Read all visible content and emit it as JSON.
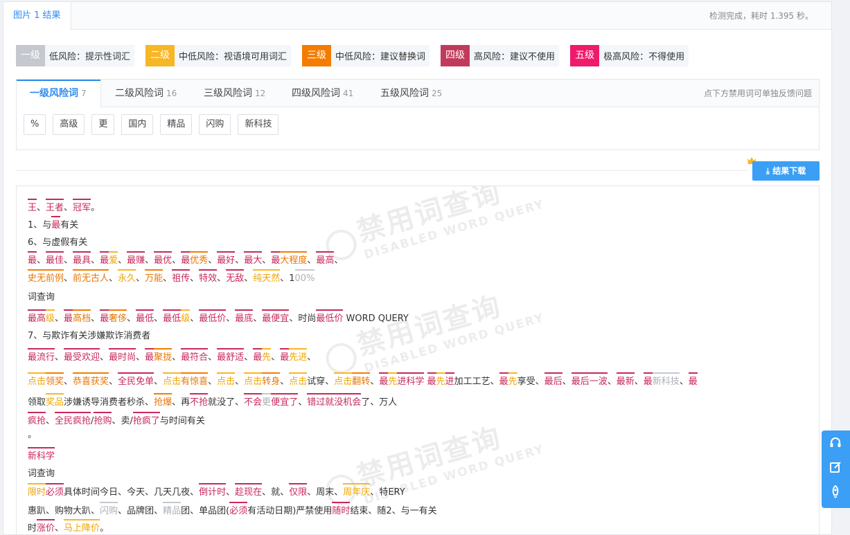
{
  "top": {
    "result_tab": "图片 1 结果",
    "status": "检测完成，耗时 1.395 秒。"
  },
  "legend": [
    {
      "level": "一级",
      "desc": "低风险：提示性词汇",
      "color": "#c5c8ce"
    },
    {
      "level": "二级",
      "desc": "中低风险：视语境可用词汇",
      "color": "#f7b624"
    },
    {
      "level": "三级",
      "desc": "中低风险：建议替换词",
      "color": "#f57c00"
    },
    {
      "level": "四级",
      "desc": "高风险：建议不使用",
      "color": "#c23a5b"
    },
    {
      "level": "五级",
      "desc": "极高风险：不得使用",
      "color": "#f01a6b"
    }
  ],
  "tabs": [
    {
      "label": "一级风险词",
      "count": "7"
    },
    {
      "label": "二级风险词",
      "count": "16"
    },
    {
      "label": "三级风险词",
      "count": "12"
    },
    {
      "label": "四级风险词",
      "count": "41"
    },
    {
      "label": "五级风险词",
      "count": "25"
    }
  ],
  "tabs_hint": "点下方禁用词可单独反馈问题",
  "chips": [
    "%",
    "高级",
    "更",
    "国内",
    "精品",
    "闪购",
    "新科技"
  ],
  "download_label": "结果下载",
  "watermark": {
    "big": "禁用词查询",
    "small": "DISABLED WORD QUERY"
  },
  "content_lines": [
    [
      [
        "王",
        4
      ],
      [
        "、",
        0
      ],
      [
        "王者",
        4
      ],
      [
        "、",
        0
      ],
      [
        "冠军",
        4
      ],
      [
        "。",
        0
      ]
    ],
    [
      [
        "1、与",
        0
      ],
      [
        "最",
        4
      ],
      [
        "有关",
        0
      ]
    ],
    [
      [
        "6、与虚假有关",
        0
      ]
    ],
    [
      [
        "最",
        4
      ],
      [
        "、",
        0
      ],
      [
        "最佳",
        4
      ],
      [
        "、",
        0
      ],
      [
        "最具",
        4
      ],
      [
        "、",
        0
      ],
      [
        "最",
        4
      ],
      [
        "爱",
        2
      ],
      [
        "、",
        0
      ],
      [
        "最赚",
        4
      ],
      [
        "、",
        0
      ],
      [
        "最优",
        4
      ],
      [
        "、",
        0
      ],
      [
        "最",
        4
      ],
      [
        "优秀",
        3
      ],
      [
        "、",
        0
      ],
      [
        "最好",
        4
      ],
      [
        "、",
        0
      ],
      [
        "最大",
        4
      ],
      [
        "、",
        0
      ],
      [
        "最",
        4
      ],
      [
        "大程度",
        3
      ],
      [
        "、",
        0
      ],
      [
        "最高",
        4
      ],
      [
        "、",
        0
      ]
    ],
    [
      [
        "史无前例",
        3
      ],
      [
        "、",
        0
      ],
      [
        "前无古人",
        3
      ],
      [
        "、",
        0
      ],
      [
        "永久",
        2
      ],
      [
        "、",
        0
      ],
      [
        "万能",
        3
      ],
      [
        "、",
        0
      ],
      [
        "祖传",
        4
      ],
      [
        "、",
        0
      ],
      [
        "特效",
        4
      ],
      [
        "、",
        0
      ],
      [
        "无敌",
        4
      ],
      [
        "、",
        0
      ],
      [
        "纯天然",
        2
      ],
      [
        "、",
        0
      ],
      [
        "1",
        0
      ],
      [
        "00%",
        1
      ]
    ],
    [
      [
        "词查询",
        0
      ]
    ],
    [
      [
        "最高",
        4
      ],
      [
        "级",
        2
      ],
      [
        "、",
        0
      ],
      [
        "最",
        4
      ],
      [
        "高档",
        3
      ],
      [
        "、",
        0
      ],
      [
        "最",
        4
      ],
      [
        "奢侈",
        3
      ],
      [
        "、",
        0
      ],
      [
        "最低",
        4
      ],
      [
        "、",
        0
      ],
      [
        "最",
        4
      ],
      [
        "低",
        4
      ],
      [
        "级",
        2
      ],
      [
        "、",
        0
      ],
      [
        "最低价",
        4
      ],
      [
        "、",
        0
      ],
      [
        "最底",
        4
      ],
      [
        "、",
        0
      ],
      [
        "最便宜",
        4
      ],
      [
        "、",
        0
      ],
      [
        "时尚",
        0
      ],
      [
        "最低价",
        4
      ],
      [
        " WORD QUERY",
        0
      ]
    ],
    [
      [
        "7、与欺诈有关涉嫌欺诈消费者",
        0
      ]
    ],
    [
      [
        "最流行",
        4
      ],
      [
        "、",
        0
      ],
      [
        "最受欢迎",
        4
      ],
      [
        "、",
        0
      ],
      [
        "最时尚",
        4
      ],
      [
        "、",
        0
      ],
      [
        "最",
        4
      ],
      [
        "聚拢",
        3
      ],
      [
        "、",
        0
      ],
      [
        "最符合",
        4
      ],
      [
        "、",
        0
      ],
      [
        "最舒适",
        4
      ],
      [
        "、",
        0
      ],
      [
        "最",
        4
      ],
      [
        "先",
        2
      ],
      [
        "、",
        0
      ],
      [
        "最",
        4
      ],
      [
        "先进",
        2
      ],
      [
        "、",
        0
      ]
    ],
    [
      [
        "点击",
        2
      ],
      [
        "领奖",
        3
      ],
      [
        "、",
        0
      ],
      [
        "恭喜获奖",
        3
      ],
      [
        "、",
        0
      ],
      [
        "全民免单",
        4
      ],
      [
        "、",
        0
      ],
      [
        "点击",
        2
      ],
      [
        "有惊喜",
        3
      ],
      [
        "、",
        0
      ],
      [
        "点击",
        2
      ],
      [
        "、",
        0
      ],
      [
        "点击",
        2
      ],
      [
        "转身",
        3
      ],
      [
        "、",
        0
      ],
      [
        "点击",
        2
      ],
      [
        "试穿",
        0
      ],
      [
        "、",
        0
      ],
      [
        "点击",
        2
      ],
      [
        "翻转",
        3
      ],
      [
        "、",
        0
      ],
      [
        "最",
        4
      ],
      [
        "先",
        2
      ],
      [
        "进科学",
        4
      ],
      [
        " ",
        0
      ],
      [
        "最",
        4
      ],
      [
        "先",
        2
      ],
      [
        "进",
        4
      ],
      [
        "加工工艺",
        0
      ],
      [
        "、",
        0
      ],
      [
        "最",
        4
      ],
      [
        "先",
        2
      ],
      [
        "享受",
        0
      ],
      [
        "、",
        0
      ],
      [
        "最后",
        4
      ],
      [
        "、",
        0
      ],
      [
        "最后一波",
        4
      ],
      [
        "、",
        0
      ],
      [
        "最新",
        4
      ],
      [
        "、",
        0
      ],
      [
        "最",
        4
      ],
      [
        "新科技",
        1
      ],
      [
        "、",
        0
      ],
      [
        "最",
        4
      ]
    ],
    [
      [
        "领取",
        0
      ],
      [
        "奖品",
        2
      ],
      [
        "涉嫌诱导消费者秒杀",
        0
      ],
      [
        "、",
        0
      ],
      [
        "抢爆",
        3
      ],
      [
        "、",
        0
      ],
      [
        "再",
        0
      ],
      [
        "不抢",
        4
      ],
      [
        "就没了",
        0
      ],
      [
        "、",
        0
      ],
      [
        "不会",
        4
      ],
      [
        "更",
        1
      ],
      [
        "便宜了",
        4
      ],
      [
        "、",
        0
      ],
      [
        "错过",
        4
      ],
      [
        "就没机会",
        4
      ],
      [
        "了",
        0
      ],
      [
        "、",
        0
      ],
      [
        "万人",
        0
      ]
    ],
    [
      [
        "疯抢",
        4
      ],
      [
        "、",
        0
      ],
      [
        "全民疯抢",
        4
      ],
      [
        "/",
        0
      ],
      [
        "抢购",
        4
      ],
      [
        "、",
        0
      ],
      [
        "卖/",
        0
      ],
      [
        "抢疯了",
        4
      ],
      [
        "与时间有关",
        0
      ]
    ],
    [
      [
        "。",
        0
      ]
    ],
    [
      [
        "新科学",
        4
      ]
    ],
    [
      [
        "词查询",
        0
      ]
    ],
    [
      [
        "限时",
        2
      ],
      [
        "必须",
        4
      ],
      [
        "具体时间今日",
        0
      ],
      [
        "、",
        0
      ],
      [
        "今天",
        0
      ],
      [
        "、",
        0
      ],
      [
        "几天几夜",
        0
      ],
      [
        "、",
        0
      ],
      [
        "倒计时",
        4
      ],
      [
        "、",
        0
      ],
      [
        "趁现在",
        4
      ],
      [
        "、",
        0
      ],
      [
        "就",
        0
      ],
      [
        "、",
        0
      ],
      [
        "仅限",
        4
      ],
      [
        "、",
        0
      ],
      [
        "周末",
        0
      ],
      [
        "、",
        0
      ],
      [
        "周年庆",
        2
      ],
      [
        "、",
        0
      ],
      [
        "特ERY",
        0
      ]
    ],
    [
      [
        "惠趴",
        0
      ],
      [
        "、",
        0
      ],
      [
        "购物大趴",
        0
      ],
      [
        "、",
        0
      ],
      [
        "闪购",
        1
      ],
      [
        "、",
        0
      ],
      [
        "品牌团",
        0
      ],
      [
        "、",
        0
      ],
      [
        "精品",
        1
      ],
      [
        "团",
        0
      ],
      [
        "、",
        0
      ],
      [
        "单品团(",
        0
      ],
      [
        "必须",
        4
      ],
      [
        "有活动日期)严禁使用",
        0
      ],
      [
        "随时",
        4
      ],
      [
        "结束",
        0
      ],
      [
        "、",
        0
      ],
      [
        "随2、与一有关",
        0
      ]
    ],
    [
      [
        "时",
        0
      ],
      [
        "涨价",
        4
      ],
      [
        "、",
        0
      ],
      [
        "马上降价",
        2
      ],
      [
        "。",
        0
      ]
    ]
  ]
}
